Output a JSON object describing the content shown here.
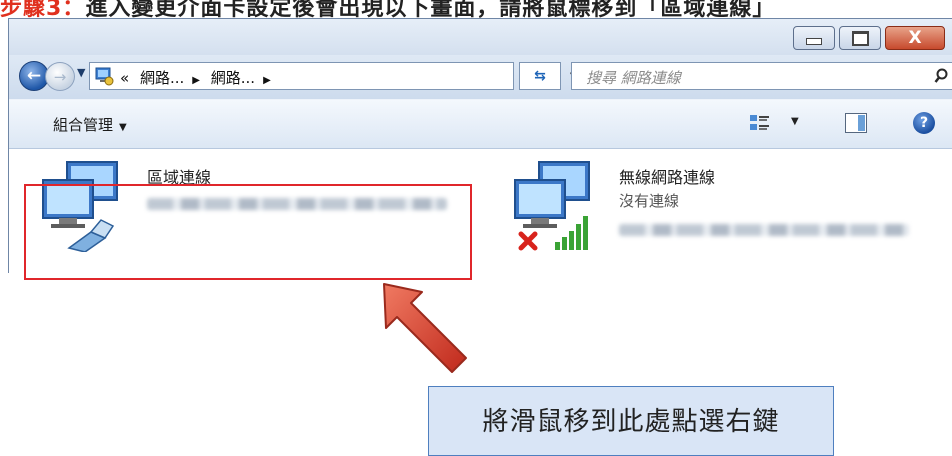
{
  "instruction": {
    "step_label": "步驟3：",
    "text": "進入變更介面卡設定後會出現以下畫面，請將鼠標移到「區域連線」"
  },
  "window": {
    "controls": {
      "close_label": "X"
    }
  },
  "nav": {
    "breadcrumb": [
      "«",
      "網路...",
      "網路..."
    ],
    "search_placeholder": "搜尋 網路連線"
  },
  "command_bar": {
    "organize_label": "組合管理"
  },
  "connections": [
    {
      "name": "區域連線",
      "status": "",
      "icon": "ethernet-network-icon"
    },
    {
      "name": "無線網路連線",
      "status": "沒有連線",
      "icon": "wireless-network-icon",
      "disconnected": true
    }
  ],
  "callout": {
    "text": "將滑鼠移到此處點選右鍵"
  },
  "colors": {
    "highlight": "#e0262b",
    "arrow": "#d83a2a",
    "callout_bg": "#d9e5f6",
    "callout_border": "#4f7fbf"
  }
}
